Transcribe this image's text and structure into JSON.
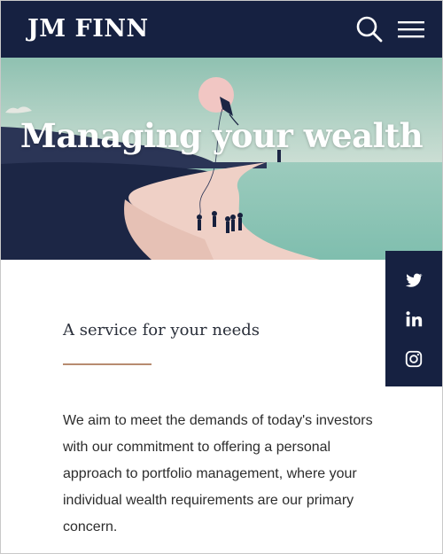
{
  "header": {
    "logo_text": "JM FINN",
    "search_icon": "search-icon",
    "menu_icon": "hamburger-menu-icon"
  },
  "hero": {
    "title": "Managing your wealth"
  },
  "social": {
    "items": [
      {
        "icon": "twitter-icon",
        "label": "Twitter"
      },
      {
        "icon": "linkedin-icon",
        "label": "LinkedIn"
      },
      {
        "icon": "instagram-icon",
        "label": "Instagram"
      }
    ]
  },
  "content": {
    "heading": "A service for your needs",
    "body": "We aim to meet the demands of today's investors with our commitment to offering a personal approach to portfolio management, where your individual wealth requirements are our primary concern."
  },
  "colors": {
    "navy": "#162141",
    "sea": "#8bc3b3",
    "sand": "#efd0c6",
    "accent_rule": "#b78b70"
  }
}
